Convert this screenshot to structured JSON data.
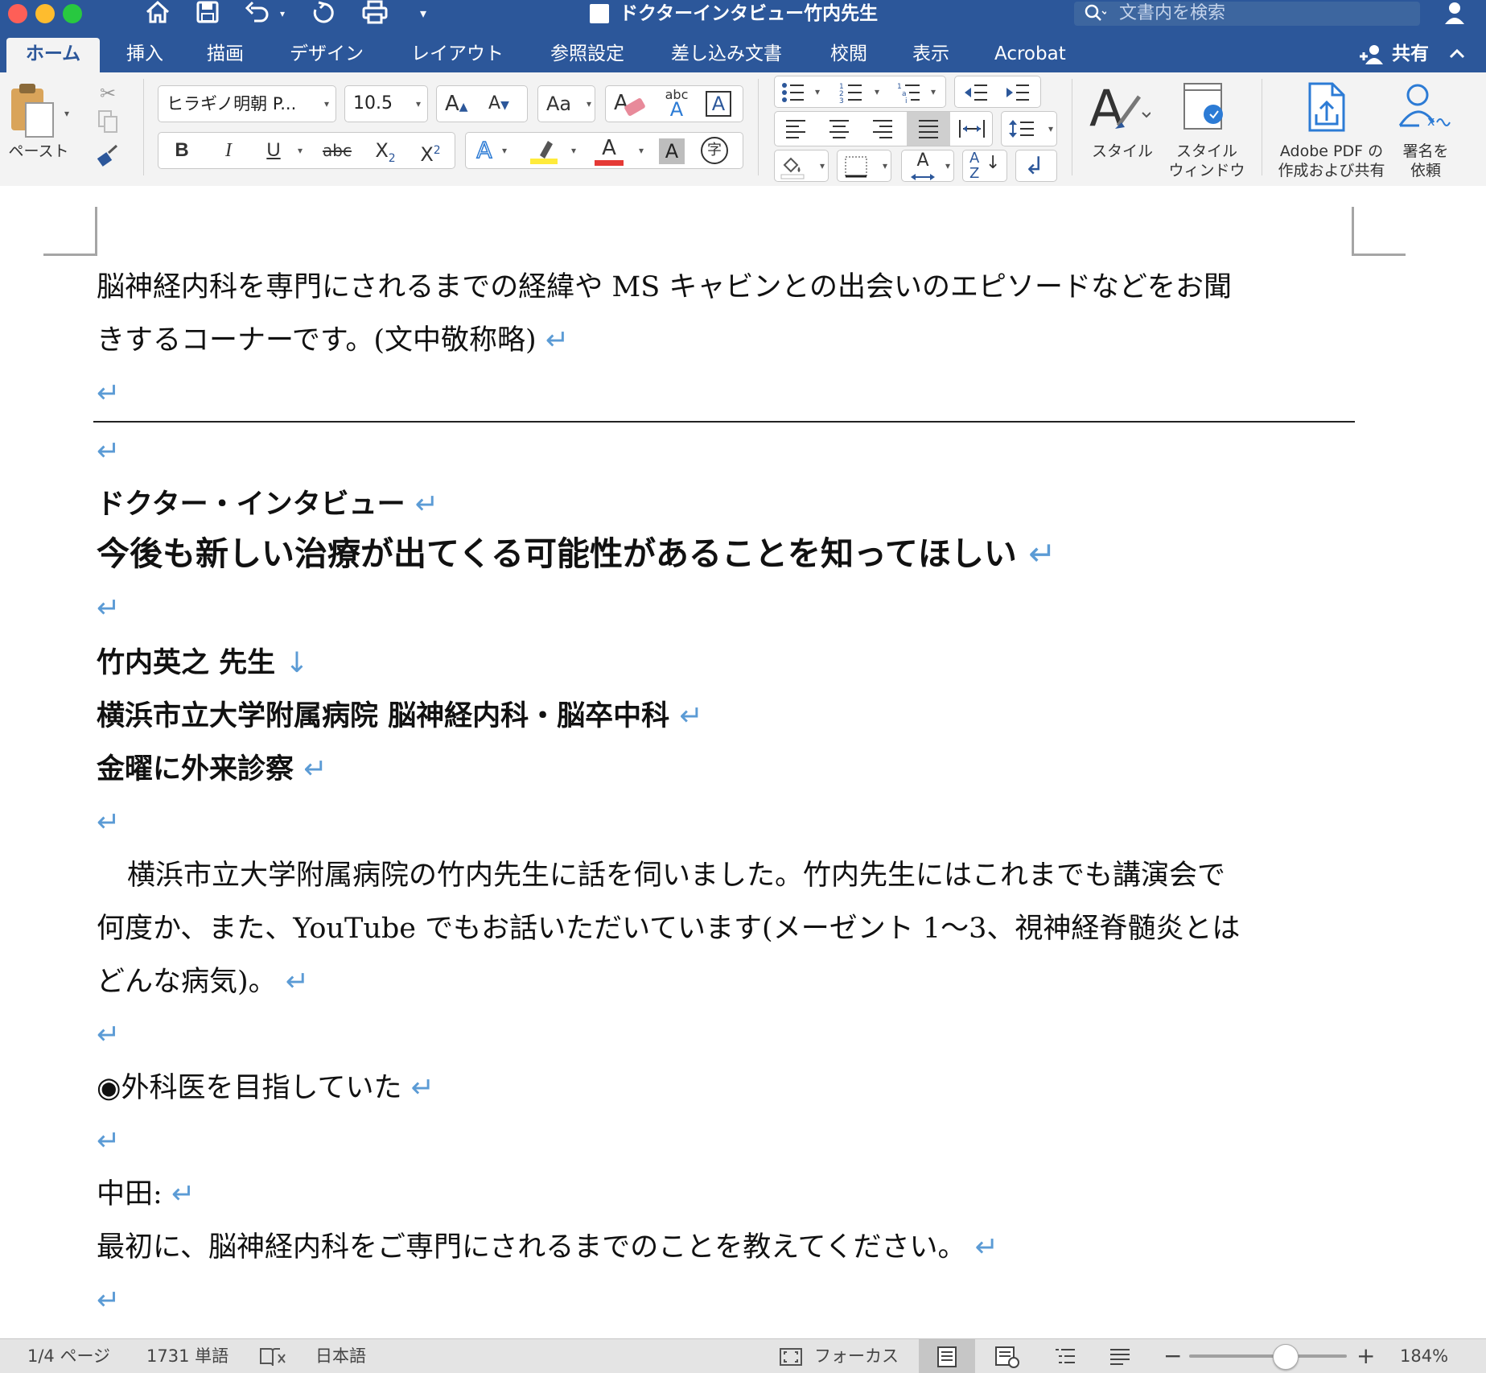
{
  "window": {
    "title": "ドクターインタビュー竹内先生",
    "search_placeholder": "文書内を検索"
  },
  "tabs": [
    {
      "label": "ホーム",
      "active": true
    },
    {
      "label": "挿入"
    },
    {
      "label": "描画"
    },
    {
      "label": "デザイン"
    },
    {
      "label": "レイアウト"
    },
    {
      "label": "参照設定"
    },
    {
      "label": "差し込み文書"
    },
    {
      "label": "校閲"
    },
    {
      "label": "表示"
    },
    {
      "label": "Acrobat"
    }
  ],
  "share_label": "共有",
  "ribbon": {
    "paste_label": "ペースト",
    "font_name": "ヒラギノ明朝 P...",
    "font_size": "10.5",
    "style_label": "スタイル",
    "style_window_label_1": "スタイル",
    "style_window_label_2": "ウィンドウ",
    "adobe_label_1": "Adobe PDF の",
    "adobe_label_2": "作成および共有",
    "sign_label_1": "署名を",
    "sign_label_2": "依頼",
    "bold": "B",
    "italic": "I",
    "underline": "U",
    "strike": "abc",
    "sub_base": "X",
    "sub_script": "2",
    "sup_base": "X",
    "sup_script": "2",
    "char_shade": "A",
    "enclosed_char": "字",
    "grow_font": "A",
    "shrink_font": "A",
    "change_case": "Aa",
    "abc_label": "abc",
    "phonetic_a": "A",
    "char_border_a": "A",
    "text_effect_a": "A",
    "font_color_a": "A",
    "style_a": "A",
    "sort_a": "A",
    "sort_z": "Z"
  },
  "document": {
    "intro_line1": "脳神経内科を専門にされるまでの経緯や MS キャビンとの出会いのエピソードなどをお聞",
    "intro_line2": "きするコーナーです。(文中敬称略)",
    "heading_small": "ドクター・インタビュー",
    "heading_large": "今後も新しい治療が出てくる可能性があることを知ってほしい",
    "doctor_name": "竹内英之  先生",
    "affiliation": "横浜市立大学附属病院  脳神経内科・脳卒中科",
    "clinic_day": "金曜に外来診察",
    "body_line1": "横浜市立大学附属病院の竹内先生に話を伺いました。竹内先生にはこれまでも講演会で",
    "body_line2": "何度か、また、YouTube でもお話いただいています(メーゼント 1〜3、視神経脊髄炎とは",
    "body_line3": "どんな病気)。",
    "section_heading": "◉外科医を目指していた",
    "speaker": "中田:",
    "question": "最初に、脳神経内科をご専門にされるまでのことを教えてください。",
    "para_mark": "↵",
    "line_break_mark": "↓"
  },
  "status_bar": {
    "page": "1/4 ページ",
    "words": "1731 単語",
    "language": "日本語",
    "focus": "フォーカス",
    "zoom": "184%",
    "zoom_minus": "−",
    "zoom_plus": "+"
  },
  "colors": {
    "word_blue": "#2c579a",
    "para_mark": "#5b9bd5",
    "ribbon_bg": "#f3f3f3"
  }
}
